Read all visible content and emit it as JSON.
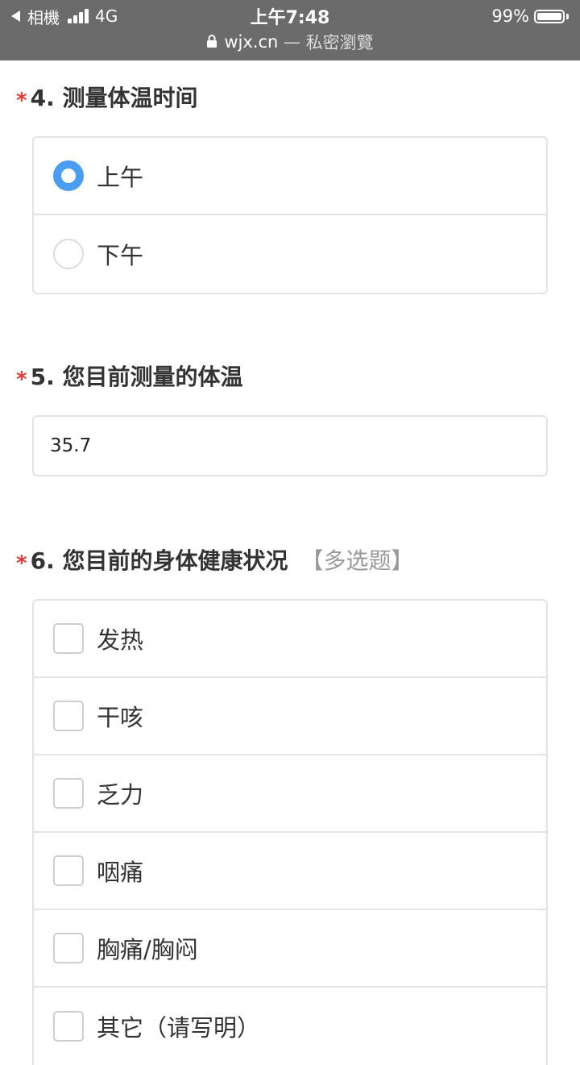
{
  "status_bar": {
    "back_app": "相機",
    "network": "4G",
    "time": "上午7:48",
    "battery_text": "99%",
    "battery_level": 0.99,
    "url": "wjx.cn",
    "url_separator": "—",
    "browse_mode": "私密瀏覽",
    "icons": [
      "back-arrow-icon",
      "signal-icon",
      "battery-icon",
      "lock-icon"
    ]
  },
  "colors": {
    "required_star": "#e53935",
    "radio_selected": "#4a9df0",
    "status_bar_bg": "#6b6b6b",
    "question_type": "#999999"
  },
  "questions": [
    {
      "required_mark": "*",
      "number": "4.",
      "title": "测量体温时间",
      "kind": "radio",
      "options": [
        {
          "label": "上午",
          "selected": true
        },
        {
          "label": "下午",
          "selected": false
        }
      ]
    },
    {
      "required_mark": "*",
      "number": "5.",
      "title": "您目前测量的体温",
      "kind": "text",
      "value": "35.7"
    },
    {
      "required_mark": "*",
      "number": "6.",
      "title": "您目前的身体健康状况",
      "type_hint": "【多选题】",
      "kind": "checkbox",
      "options": [
        {
          "label": "发热",
          "checked": false
        },
        {
          "label": "干咳",
          "checked": false
        },
        {
          "label": "乏力",
          "checked": false
        },
        {
          "label": "咽痛",
          "checked": false
        },
        {
          "label": "胸痛/胸闷",
          "checked": false
        },
        {
          "label": "其它（请写明）",
          "checked": false
        }
      ]
    }
  ]
}
